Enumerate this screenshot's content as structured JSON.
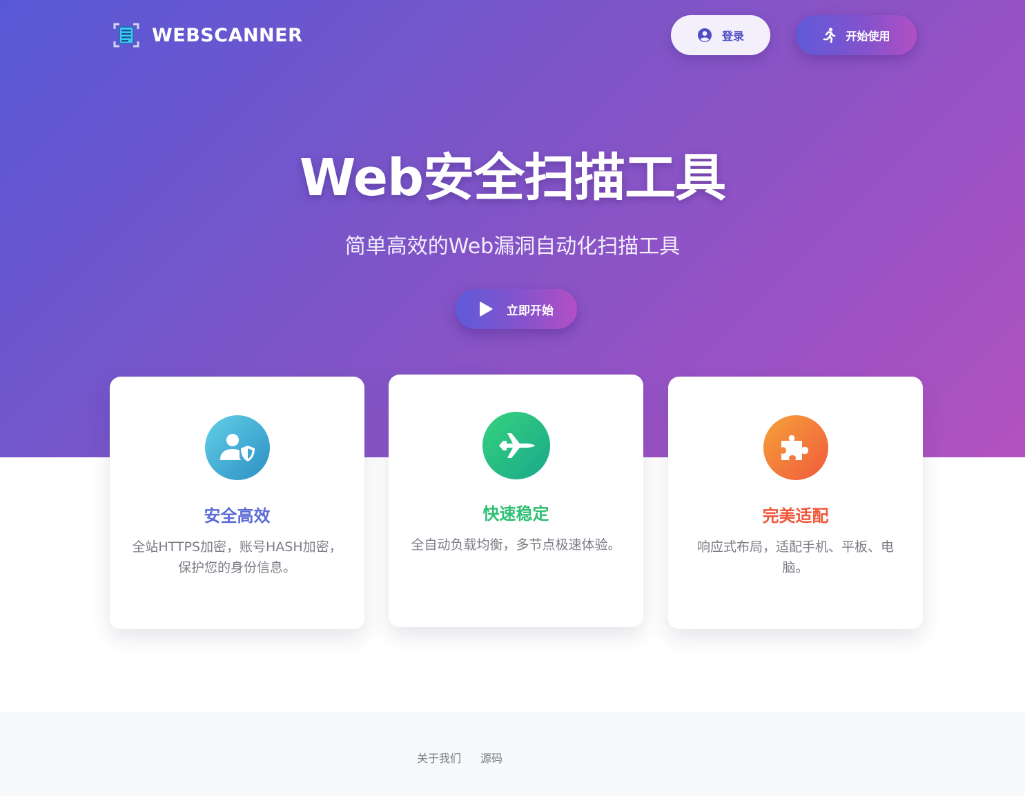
{
  "header": {
    "brand": "WEBSCANNER",
    "login_label": "登录",
    "start_label": "开始使用"
  },
  "hero": {
    "title": "Web安全扫描工具",
    "subtitle": "简单高效的Web漏洞自动化扫描工具",
    "cta_label": "立即开始"
  },
  "features": [
    {
      "title": "安全高效",
      "desc": "全站HTTPS加密，账号HASH加密，保护您的身份信息。",
      "icon": "user-shield-icon",
      "color": "#5b6bd6"
    },
    {
      "title": "快速稳定",
      "desc": "全自动负载均衡，多节点极速体验。",
      "icon": "fighter-jet-icon",
      "color": "#2fbf74"
    },
    {
      "title": "完美适配",
      "desc": "响应式布局，适配手机、平板、电脑。",
      "icon": "puzzle-piece-icon",
      "color": "#f0563a"
    }
  ],
  "footer": {
    "links": [
      "关于我们",
      "源码"
    ]
  },
  "colors": {
    "hero_gradient_start": "#5858d6",
    "hero_gradient_end": "#b252c0",
    "accent": "#4d4ec7"
  }
}
